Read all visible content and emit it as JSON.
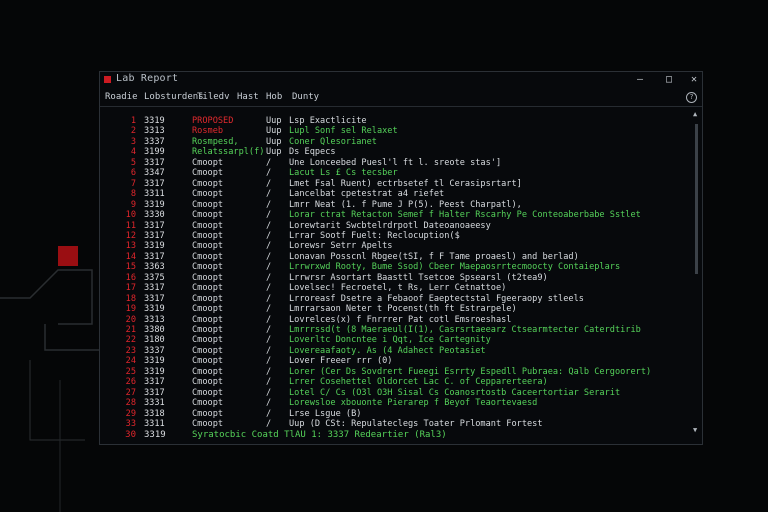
{
  "window": {
    "title": "Lab Report",
    "menu": [
      "Roadie",
      "Lobsturdens",
      "Tiledv",
      "Hast",
      "Hob",
      "Dunty"
    ]
  },
  "rows": [
    {
      "num": "1",
      "code": "3319",
      "name": "PROPOSED",
      "type": "Uup",
      "desc": "Lsp Exactlicite",
      "nameColor": "red"
    },
    {
      "num": "2",
      "code": "3313",
      "name": "Rosmeb",
      "type": "Uup",
      "desc": "Lupl Sonf sel Relaxet",
      "nameColor": "red",
      "descColor": "green"
    },
    {
      "num": "3",
      "code": "3337",
      "name": "Rosmpesd,",
      "type": "Uup",
      "desc": "Coner Qlesorianet",
      "nameColor": "green",
      "descColor": "green"
    },
    {
      "num": "4",
      "code": "3199",
      "name": "Relatssarpl(f)",
      "type": "Uup",
      "desc": "Ds Eqpecs",
      "nameColor": "green"
    },
    {
      "num": "5",
      "code": "3317",
      "name": "Cmoopt",
      "type": "/",
      "desc": "Une Lonceebed Puesl'l ft l. sreote stas']"
    },
    {
      "num": "6",
      "code": "3347",
      "name": "Cmoopt",
      "type": "/",
      "desc": "Lacut Ls  £  Cs tecsber",
      "descColor": "green"
    },
    {
      "num": "7",
      "code": "3317",
      "name": "Cmoopt",
      "type": "/",
      "desc": "Lmet Fsal Ruent) ectrbsetef tl Cerasipsrtart]"
    },
    {
      "num": "8",
      "code": "3311",
      "name": "Cmoopt",
      "type": "/",
      "desc": "Lancelbat cpetestrat a4 riefet"
    },
    {
      "num": "9",
      "code": "3319",
      "name": "Cmoopt",
      "type": "/",
      "desc": "Lmrr Neat (1. f  Pume  J  P(5). Peest Charpatl),"
    },
    {
      "num": "10",
      "code": "3330",
      "name": "Cmoopt",
      "type": "/",
      "desc": "Lorar ctrat Retacton Semef f  Halter Rscarhy Pe Conteoaberbabe Sstlet",
      "descColor": "green"
    },
    {
      "num": "11",
      "code": "3317",
      "name": "Cmoopt",
      "type": "/",
      "desc": "Lorewtarit Swcbtelrdrpotl Dateoanoaeesy"
    },
    {
      "num": "12",
      "code": "3317",
      "name": "Cmoopt",
      "type": "/",
      "desc": "Lrrar Sootf Fuelt: Reclocuption($"
    },
    {
      "num": "13",
      "code": "3319",
      "name": "Cmoopt",
      "type": "/",
      "desc": "Lorewsr Setrr Apelts"
    },
    {
      "num": "14",
      "code": "3317",
      "name": "Cmoopt",
      "type": "/",
      "desc": "Lonavan Posscnl Rbgee(tSI, f  F Tame proaesl) and berlad)"
    },
    {
      "num": "15",
      "code": "3363",
      "name": "Cmoopt",
      "type": "/",
      "desc": "Lrrwrxwd Rooty, Bume Ssod) Cbeer Maepaosrrtecmoocty Contaieplars",
      "descColor": "green"
    },
    {
      "num": "16",
      "code": "3375",
      "name": "Cmoopt",
      "type": "/",
      "desc": "Lrrwrsr Asortart Baasttl Tsetcoe Spsearsl (t2tea9)"
    },
    {
      "num": "17",
      "code": "3317",
      "name": "Cmoopt",
      "type": "/",
      "desc": "Lovelsec! Fecroetel, t  Rs, Lerr Cetnattoe)"
    },
    {
      "num": "18",
      "code": "3317",
      "name": "Cmoopt",
      "type": "/",
      "desc": "Lrroreasf Dsetre a  Febaoof Eaeptectstal Fgeeraopy stleels"
    },
    {
      "num": "19",
      "code": "3319",
      "name": "Cmoopt",
      "type": "/",
      "desc": "Lmrrarsaon Neter t Pocenst(th ft Estrarpele)"
    },
    {
      "num": "20",
      "code": "3313",
      "name": "Cmoopt",
      "type": "/",
      "desc": "Lovrelces(x)  f  Fnrrrer Pat cotl Emsroeshasl"
    },
    {
      "num": "21",
      "code": "3380",
      "name": "Cmoopt",
      "type": "/",
      "desc": "Lmrrrssd(t  (8 Maeraeul(I(1),  Casrsrtaeearz Ctsearmtecter Caterdtirib",
      "descColor": "green"
    },
    {
      "num": "22",
      "code": "3180",
      "name": "Cmoopt",
      "type": "/",
      "desc": "Loverltc Doncntee  i  Qqt,  Ice Cartegnity",
      "descColor": "green"
    },
    {
      "num": "23",
      "code": "3337",
      "name": "Cmoopt",
      "type": "/",
      "desc": "Lovereaafaoty.  As  (4 Adahect Peotasiet",
      "descColor": "green"
    },
    {
      "num": "24",
      "code": "3319",
      "name": "Cmoopt",
      "type": "/",
      "desc": "Lover Freeer  rrr (0)"
    },
    {
      "num": "25",
      "code": "3319",
      "name": "Cmoopt",
      "type": "/",
      "desc": "Lorer (Cer Ds Sovdrert Fueegi Esrrty Espedll Pubraea: Qalb Cergoorert)",
      "descColor": "green"
    },
    {
      "num": "26",
      "code": "3317",
      "name": "Cmoopt",
      "type": "/",
      "desc": "Lrrer Cosehettel Oldorcet Lac  C. of Cepparerteera)",
      "descColor": "green"
    },
    {
      "num": "27",
      "code": "3317",
      "name": "Cmoopt",
      "type": "/",
      "desc": "Lotel C/ Cs (O3l  O3H Sisal  Cs Coanosrtostb Caceertortiar Serarit",
      "descColor": "green"
    },
    {
      "num": "28",
      "code": "3331",
      "name": "Cmoopt",
      "type": "/",
      "desc": "Lorewsloe xbouonte Pierarep f Beyof Teaortevaesd",
      "descColor": "green"
    },
    {
      "num": "29",
      "code": "3318",
      "name": "Cmoopt",
      "type": "/",
      "desc": "Lrse Lsgue (B)"
    },
    {
      "num": "33",
      "code": "3311",
      "name": "Cmoopt",
      "type": "/",
      "desc": "Uup (D CSt: Repulateclegs Toater Prlomant Fortest"
    }
  ],
  "footer": {
    "num": "30",
    "code": "3319",
    "text": "Syratocbic Coatd TlAU  1: 3337  Redeartier  (Ral3)"
  },
  "icons": {
    "minimize": "minimize-icon",
    "maximize": "maximize-icon",
    "close": "close-icon",
    "help": "help-icon"
  },
  "colors": {
    "accent_red": "#e0262c",
    "accent_green": "#56d45a",
    "background": "#050607"
  }
}
